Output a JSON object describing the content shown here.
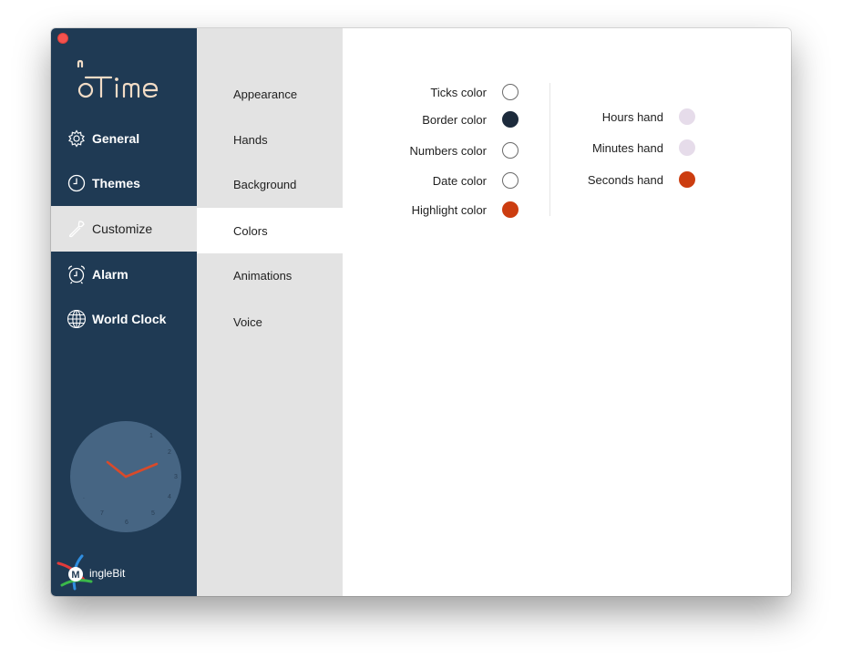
{
  "window": {
    "close_button": "close"
  },
  "app": {
    "logo_text": "Time",
    "logo_prefix": "on"
  },
  "sidebar": {
    "items": [
      {
        "label": "General",
        "icon": "gear-icon"
      },
      {
        "label": "Themes",
        "icon": "clock-icon"
      },
      {
        "label": "Customize",
        "icon": "wrench-icon"
      },
      {
        "label": "Alarm",
        "icon": "alarm-clock-icon"
      },
      {
        "label": "World Clock",
        "icon": "globe-icon"
      }
    ],
    "active": "Customize",
    "clock_numbers": [
      "1",
      "2",
      "3",
      "4",
      "5",
      "6",
      "7",
      "."
    ],
    "brand_letter": "M",
    "brand_text": "ingleBit"
  },
  "subnav": {
    "items": [
      {
        "label": "Appearance"
      },
      {
        "label": "Hands"
      },
      {
        "label": "Background"
      },
      {
        "label": "Colors"
      },
      {
        "label": "Animations"
      },
      {
        "label": "Voice"
      }
    ],
    "active": "Colors"
  },
  "colors": {
    "left": [
      {
        "label": "Ticks color",
        "color": "#ffffff"
      },
      {
        "label": "Border color",
        "color": "#1d2b3c"
      },
      {
        "label": "Numbers color",
        "color": "#ffffff"
      },
      {
        "label": "Date color",
        "color": "#ffffff"
      },
      {
        "label": "Highlight color",
        "color": "#cc3d10"
      }
    ],
    "right": [
      {
        "label": "Hours hand",
        "color": "#e6dcea"
      },
      {
        "label": "Minutes hand",
        "color": "#e6dcea"
      },
      {
        "label": "Seconds hand",
        "color": "#cc3d10"
      }
    ]
  },
  "theme": {
    "sidebar_bg": "#1f3a54",
    "subnav_bg": "#e3e3e3",
    "accent_red": "#cc3d10",
    "logo_color": "#f2dcc6"
  }
}
